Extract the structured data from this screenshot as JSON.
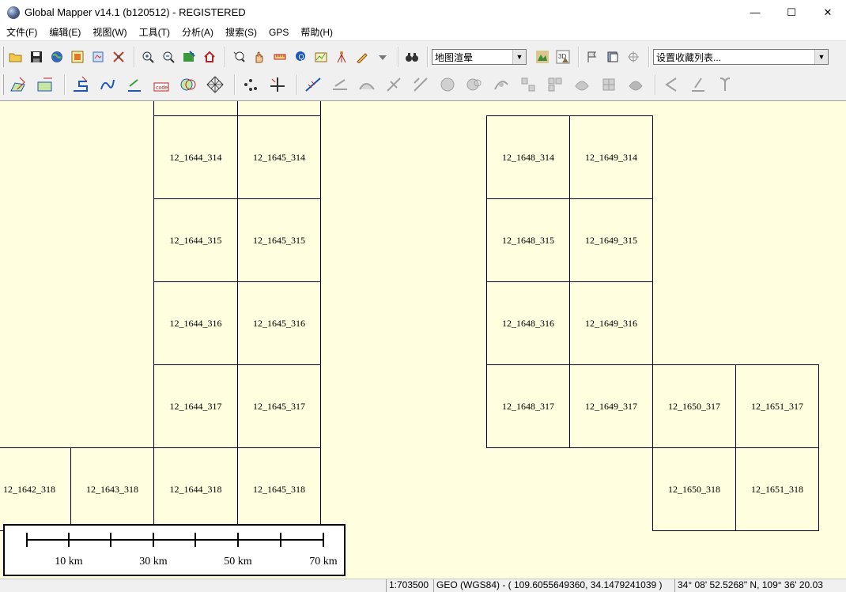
{
  "window": {
    "title": "Global Mapper v14.1 (b120512) - REGISTERED",
    "minimize_glyph": "—",
    "maximize_glyph": "☐",
    "close_glyph": "✕"
  },
  "menu": [
    "文件(F)",
    "编辑(E)",
    "视图(W)",
    "工具(T)",
    "分析(A)",
    "搜索(S)",
    "GPS",
    "帮助(H)"
  ],
  "toolbar": {
    "shader_combo_value": "地图渲晕",
    "favorites_combo_value": "设置收藏列表..."
  },
  "map": {
    "background_color": "#ffffe0",
    "tiles": [
      {
        "label": ""
      },
      {
        "label": ""
      },
      {
        "label": "12_1644_314"
      },
      {
        "label": "12_1645_314"
      },
      {
        "label": "12_1644_315"
      },
      {
        "label": "12_1645_315"
      },
      {
        "label": "12_1644_316"
      },
      {
        "label": "12_1645_316"
      },
      {
        "label": "12_1644_317"
      },
      {
        "label": "12_1645_317"
      },
      {
        "label": "12_1642_318"
      },
      {
        "label": "12_1643_318"
      },
      {
        "label": "12_1644_318"
      },
      {
        "label": "12_1645_318"
      },
      {
        "label": "12_1648_314"
      },
      {
        "label": "12_1649_314"
      },
      {
        "label": "12_1648_315"
      },
      {
        "label": "12_1649_315"
      },
      {
        "label": "12_1648_316"
      },
      {
        "label": "12_1649_316"
      },
      {
        "label": "12_1648_317"
      },
      {
        "label": "12_1649_317"
      },
      {
        "label": "12_1650_317"
      },
      {
        "label": "12_1651_317"
      },
      {
        "label": "12_1650_318"
      },
      {
        "label": "12_1651_318"
      }
    ],
    "scale_bar": {
      "labels": [
        "10 km",
        "30 km",
        "50 km",
        "70 km"
      ]
    }
  },
  "status": {
    "scale": "1:703500",
    "projection": "GEO (WGS84) - ( 109.6055649360, 34.1479241039 )",
    "dms": "34° 08' 52.5268\" N, 109° 36' 20.03"
  }
}
